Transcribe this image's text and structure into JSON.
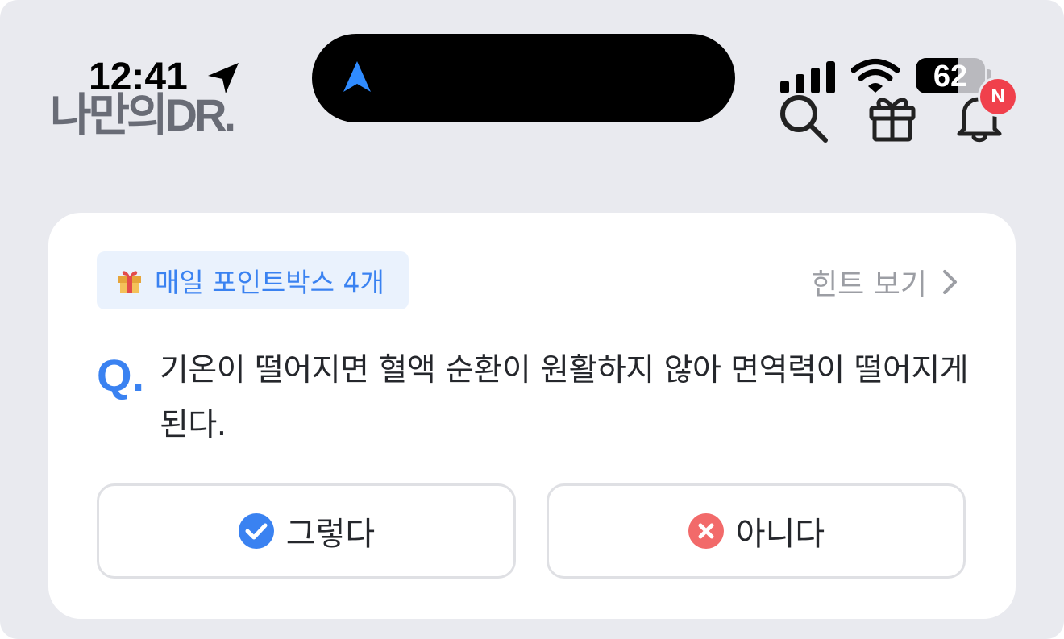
{
  "status_bar": {
    "time": "12:41",
    "battery": "62",
    "battery_level": 0.62,
    "location_icon": "location-arrow-icon",
    "island_icon": "navigation-arrow-icon"
  },
  "header": {
    "logo": "나만의DR.",
    "icons": [
      "search-icon",
      "gift-icon",
      "bell-icon"
    ],
    "notification_badge": "N"
  },
  "quiz": {
    "point_chip": {
      "icon": "gift-emoji-icon",
      "label": "매일 포인트박스 4개"
    },
    "hint": {
      "label": "힌트 보기",
      "icon": "chevron-right-icon"
    },
    "q_marker": "Q.",
    "question": "기온이 떨어지면 혈액 순환이 원활하지 않아 면역력이 떨어지게 된다.",
    "answers": [
      {
        "label": "그렇다",
        "icon": "check-circle-icon",
        "color": "#3a82f1"
      },
      {
        "label": "아니다",
        "icon": "x-circle-icon",
        "color": "#f26a6a"
      }
    ]
  },
  "colors": {
    "background": "#e9eaef",
    "accent_blue": "#3a82f1",
    "badge_red": "#f0404c",
    "logo_gray": "#696c76"
  }
}
